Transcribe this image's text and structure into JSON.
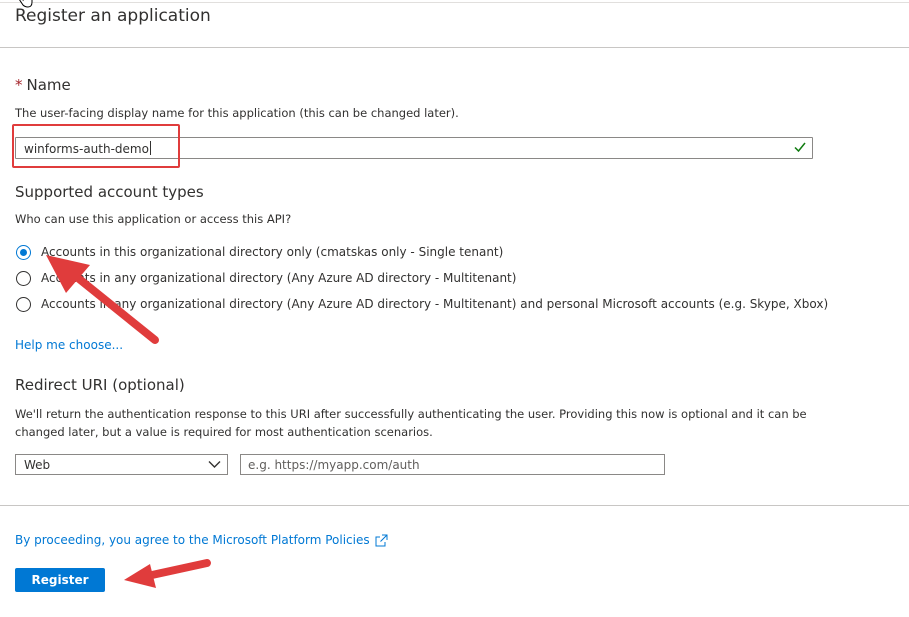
{
  "page": {
    "title": "Register an application"
  },
  "name_section": {
    "required_mark": "*",
    "title": "Name",
    "description": "The user-facing display name for this application (this can be changed later).",
    "value": "winforms-auth-demo"
  },
  "account_types": {
    "title": "Supported account types",
    "question": "Who can use this application or access this API?",
    "options": [
      {
        "label": "Accounts in this organizational directory only (cmatskas only - Single tenant)",
        "selected": true
      },
      {
        "label": "Accounts in any organizational directory (Any Azure AD directory - Multitenant)",
        "selected": false
      },
      {
        "label": "Accounts in any organizational directory (Any Azure AD directory - Multitenant) and personal Microsoft accounts (e.g. Skype, Xbox)",
        "selected": false
      }
    ],
    "help_link": "Help me choose..."
  },
  "redirect": {
    "title": "Redirect URI (optional)",
    "description": "We'll return the authentication response to this URI after successfully authenticating the user. Providing this now is optional and it can be changed later, but a value is required for most authentication scenarios.",
    "platform_value": "Web",
    "uri_placeholder": "e.g. https://myapp.com/auth",
    "uri_value": ""
  },
  "footer": {
    "policy_text": "By proceeding, you agree to the Microsoft Platform Policies",
    "register_label": "Register"
  },
  "colors": {
    "accent": "#0078d4",
    "annotation_red": "#e03c3c",
    "valid_green": "#107c10"
  },
  "icons": {
    "cursor": "hand-cursor-icon",
    "valid": "checkmark-icon",
    "dropdown": "chevron-down-icon",
    "external": "external-link-icon"
  }
}
